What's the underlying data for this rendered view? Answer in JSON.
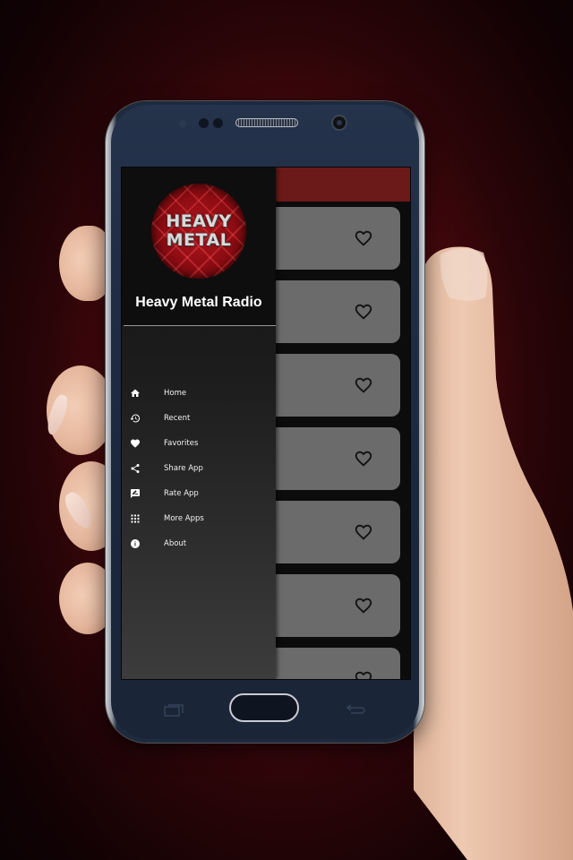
{
  "app": {
    "name": "Heavy Metal Radio",
    "logo_line1": "HEAVY",
    "logo_line2": "METAL",
    "colors": {
      "app_bar": "#6b1a19",
      "card": "#6b6b6b",
      "drawer_header": "#0e0e0e",
      "logo_red": "#b3161e"
    }
  },
  "drawer": {
    "items": [
      {
        "label": "Home",
        "icon": "home-icon"
      },
      {
        "label": "Recent",
        "icon": "history-icon"
      },
      {
        "label": "Favorites",
        "icon": "heart-icon"
      },
      {
        "label": "Share App",
        "icon": "share-icon"
      },
      {
        "label": "Rate App",
        "icon": "rate-review-icon"
      },
      {
        "label": "More Apps",
        "icon": "apps-grid-icon"
      },
      {
        "label": "About",
        "icon": "info-icon"
      }
    ]
  },
  "station_list": {
    "cards": [
      {
        "favorite_icon": "heart-outline-icon"
      },
      {
        "favorite_icon": "heart-outline-icon"
      },
      {
        "favorite_icon": "heart-outline-icon"
      },
      {
        "favorite_icon": "heart-outline-icon"
      },
      {
        "favorite_icon": "heart-outline-icon"
      },
      {
        "favorite_icon": "heart-outline-icon"
      },
      {
        "favorite_icon": "heart-outline-icon"
      }
    ]
  },
  "device": {
    "hardware_keys": [
      "recent-apps-key",
      "home-button",
      "back-key"
    ]
  }
}
